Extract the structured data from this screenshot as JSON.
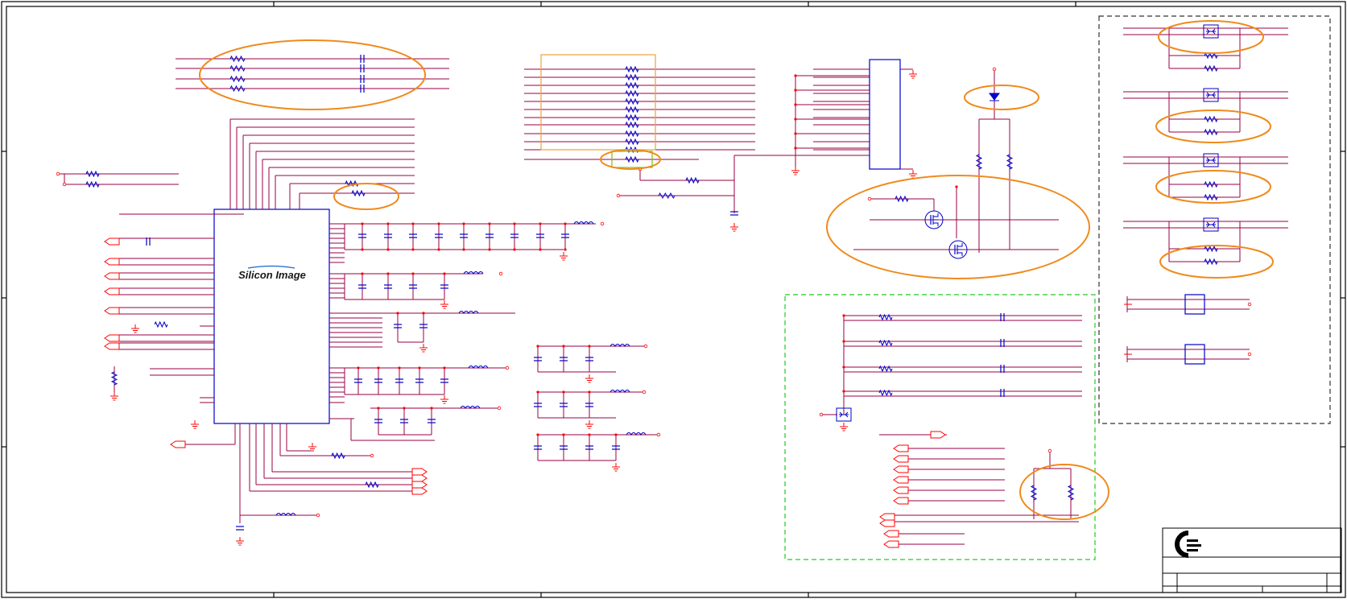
{
  "schematic": {
    "chip_label": "Silicon Image",
    "colors": {
      "border": "#000000",
      "wire": "#990044",
      "pin": "#ff0000",
      "component": "#0000cc",
      "highlight_ellipse": "#f08a1c",
      "highlight_box_orange": "#f0a040",
      "highlight_box_green": "#7ac01a",
      "dashed_green": "#22cc22",
      "dashed_black": "#333333"
    },
    "icons": {
      "title_logo": "company-logo-icon"
    }
  }
}
